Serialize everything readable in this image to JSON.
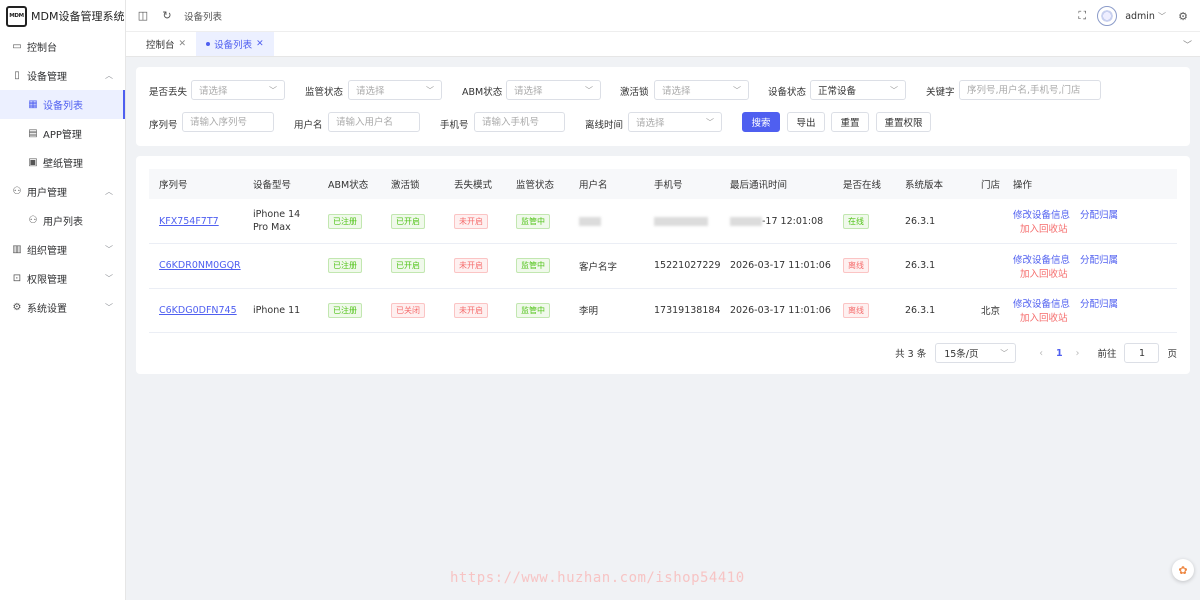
{
  "brand": {
    "logo": "MDM",
    "title": "MDM设备管理系统"
  },
  "sidebar": {
    "items": [
      {
        "label": "控制台",
        "icon": "monitor-icon"
      },
      {
        "label": "设备管理",
        "icon": "phone-icon"
      },
      {
        "label": "设备列表",
        "icon": "grid-icon"
      },
      {
        "label": "APP管理",
        "icon": "box-icon"
      },
      {
        "label": "壁纸管理",
        "icon": "image-icon"
      },
      {
        "label": "用户管理",
        "icon": "user-icon"
      },
      {
        "label": "用户列表",
        "icon": "user-icon"
      },
      {
        "label": "组织管理",
        "icon": "org-icon"
      },
      {
        "label": "权限管理",
        "icon": "lock-icon"
      },
      {
        "label": "系统设置",
        "icon": "gear-icon"
      }
    ]
  },
  "header": {
    "breadcrumb": "设备列表",
    "user": "admin"
  },
  "tabs": [
    {
      "label": "控制台"
    },
    {
      "label": "设备列表"
    }
  ],
  "filters": {
    "lost": {
      "label": "是否丢失",
      "placeholder": "请选择"
    },
    "supervise": {
      "label": "监管状态",
      "placeholder": "请选择"
    },
    "abm": {
      "label": "ABM状态",
      "placeholder": "请选择"
    },
    "activation_lock": {
      "label": "激活锁",
      "placeholder": "请选择"
    },
    "device_status": {
      "label": "设备状态",
      "value": "正常设备"
    },
    "keyword": {
      "label": "关键字",
      "placeholder": "序列号,用户名,手机号,门店"
    },
    "serial": {
      "label": "序列号",
      "placeholder": "请输入序列号"
    },
    "username": {
      "label": "用户名",
      "placeholder": "请输入用户名"
    },
    "phone": {
      "label": "手机号",
      "placeholder": "请输入手机号"
    },
    "offline_time": {
      "label": "离线时间",
      "placeholder": "请选择"
    }
  },
  "buttons": {
    "search": "搜索",
    "export": "导出",
    "reset": "重置",
    "reset_perm": "重置权限"
  },
  "table": {
    "columns": [
      "序列号",
      "设备型号",
      "ABM状态",
      "激活锁",
      "丢失模式",
      "监管状态",
      "用户名",
      "手机号",
      "最后通讯时间",
      "是否在线",
      "系统版本",
      "门店",
      "操作"
    ],
    "rows": [
      {
        "serial": "KFX754F7T7",
        "model": "iPhone 14 Pro Max",
        "abm": "已注册",
        "lock": "已开启",
        "lock_color": "green",
        "lost": "未开启",
        "supervise": "监管中",
        "user": "",
        "phone": "",
        "last": "-17 12:01:08",
        "online": "在线",
        "online_color": "green",
        "os": "26.3.1",
        "store": ""
      },
      {
        "serial": "C6KDR0NM0GQR",
        "model": "",
        "abm": "已注册",
        "lock": "已开启",
        "lock_color": "green",
        "lost": "未开启",
        "supervise": "监管中",
        "user": "客户名字",
        "phone": "15221027229",
        "last": "2026-03-17 11:01:06",
        "online": "离线",
        "online_color": "red",
        "os": "26.3.1",
        "store": ""
      },
      {
        "serial": "C6KDG0DFN745",
        "model": "iPhone 11",
        "abm": "已注册",
        "lock": "已关闭",
        "lock_color": "red",
        "lost": "未开启",
        "supervise": "监管中",
        "user": "李明",
        "phone": "17319138184",
        "last": "2026-03-17 11:01:06",
        "online": "离线",
        "online_color": "red",
        "os": "26.3.1",
        "store": "北京"
      }
    ],
    "actions": {
      "edit": "修改设备信息",
      "assign": "分配归属",
      "recycle": "加入回收站"
    }
  },
  "pagination": {
    "total": "共 3 条",
    "page_size": "15条/页",
    "current": "1",
    "goto_label": "前往",
    "goto_value": "1",
    "page_unit": "页"
  },
  "watermark": "https://www.huzhan.com/ishop54410"
}
